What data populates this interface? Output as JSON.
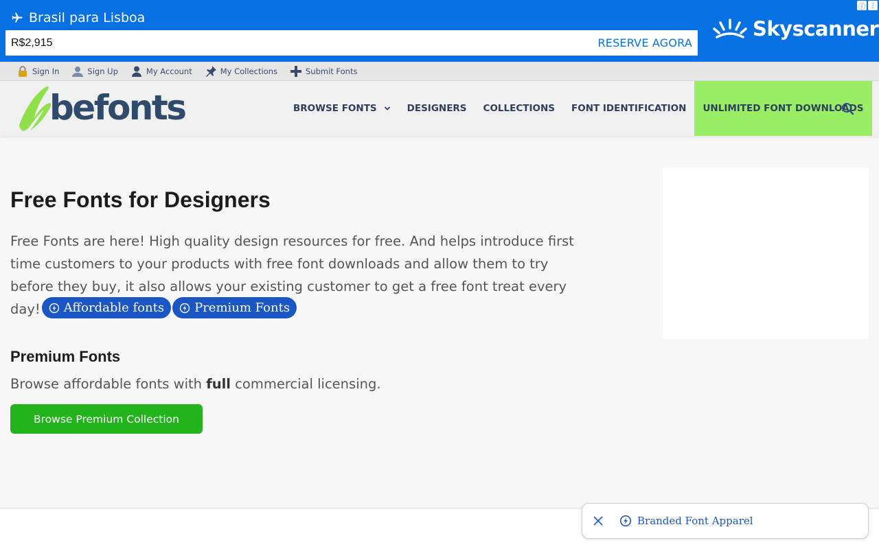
{
  "ad": {
    "title": "Brasil para Lisboa",
    "price": "R$2,915",
    "cta": "RESERVE AGORA",
    "brand": "Skyscanner",
    "info_glyph": "ⓘ",
    "menu_glyph": "⋮",
    "bg_color": "#0770e3"
  },
  "account_bar": {
    "items": [
      {
        "label": "Sign In",
        "icon": "lock-icon"
      },
      {
        "label": "Sign Up",
        "icon": "user-add-icon"
      },
      {
        "label": "My Account",
        "icon": "user-icon"
      },
      {
        "label": "My Collections",
        "icon": "pin-icon"
      },
      {
        "label": "Submit Fonts",
        "icon": "plus-icon"
      }
    ]
  },
  "header": {
    "logo_text": "befonts",
    "nav": [
      {
        "label": "BROWSE FONTS",
        "has_dropdown": true
      },
      {
        "label": "DESIGNERS"
      },
      {
        "label": "COLLECTIONS"
      },
      {
        "label": "FONT IDENTIFICATION"
      },
      {
        "label": "UNLIMITED FONT DOWNLOADS",
        "highlight_color": "#99ee66"
      }
    ],
    "search_icon": "search-icon"
  },
  "main": {
    "title": "Free Fonts for Designers",
    "intro": "Free Fonts are here! High quality design resources for free. And helps introduce first time customers to your products with free font downloads and allow them to try before they buy, it also allows your existing customer to get a free font treat every day!",
    "pills": [
      "Affordable fonts",
      "Premium Fonts"
    ],
    "section_title": "Premium Fonts",
    "section_text_before": "Browse affordable fonts with ",
    "section_text_bold": "full",
    "section_text_after": " commercial licensing.",
    "cta_button": "Browse Premium Collection",
    "cta_color": "#22b31d"
  },
  "toast": {
    "label": "Branded Font Apparel",
    "close_icon": "close-icon",
    "icon": "bolt-circle-icon"
  }
}
